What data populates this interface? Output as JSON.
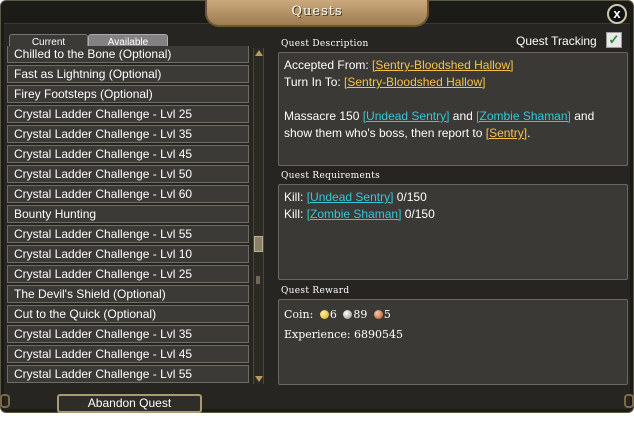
{
  "window": {
    "title": "Quests",
    "close_label": "x"
  },
  "tabs": [
    {
      "label": "Current",
      "active": true
    },
    {
      "label": "Available",
      "active": false
    }
  ],
  "quest_list": [
    "Chilled to the Bone (Optional)",
    "Fast as Lightning (Optional)",
    "Firey Footsteps (Optional)",
    "Crystal Ladder Challenge - Lvl 25",
    "Crystal Ladder Challenge - Lvl 35",
    "Crystal Ladder Challenge - Lvl 45",
    "Crystal Ladder Challenge - Lvl 50",
    "Crystal Ladder Challenge - Lvl 60",
    "Bounty Hunting",
    "Crystal Ladder Challenge - Lvl 55",
    "Crystal Ladder Challenge - Lvl 10",
    "Crystal Ladder Challenge - Lvl 25",
    "The Devil's Shield (Optional)",
    "Cut to the Quick (Optional)",
    "Crystal Ladder Challenge - Lvl 35",
    "Crystal Ladder Challenge - Lvl 45",
    "Crystal Ladder Challenge - Lvl 55"
  ],
  "abandon_label": "Abandon Quest",
  "tracking": {
    "label": "Quest Tracking",
    "checked": true
  },
  "description": {
    "title": "Quest Description",
    "accepted_label": "Accepted From:",
    "accepted_from": "[Sentry-Bloodshed Hallow]",
    "turnin_label": "Turn In To:",
    "turn_in_to": "[Sentry-Bloodshed Hallow]",
    "body_1": "Massacre 150",
    "link_1": "[Undead Sentry]",
    "body_2": "and",
    "link_2": "[Zombie Shaman]",
    "body_3": "and show them who's boss, then report to",
    "link_3": "[Sentry]",
    "body_4": "."
  },
  "requirements": {
    "title": "Quest Requirements",
    "items": [
      {
        "prefix": "Kill:",
        "target": "[Undead Sentry]",
        "progress": "0/150"
      },
      {
        "prefix": "Kill:",
        "target": "[Zombie Shaman]",
        "progress": "0/150"
      }
    ]
  },
  "reward": {
    "title": "Quest Reward",
    "coin_label": "Coin:",
    "gold": "6",
    "silver": "89",
    "copper": "5",
    "experience_label": "Experience:",
    "experience": "6890545"
  },
  "colors": {
    "link_yellow": "#f6c24a",
    "link_cyan": "#36c7d8",
    "panel_bg": "#3a3935",
    "window_bg": "#1b1b18"
  }
}
